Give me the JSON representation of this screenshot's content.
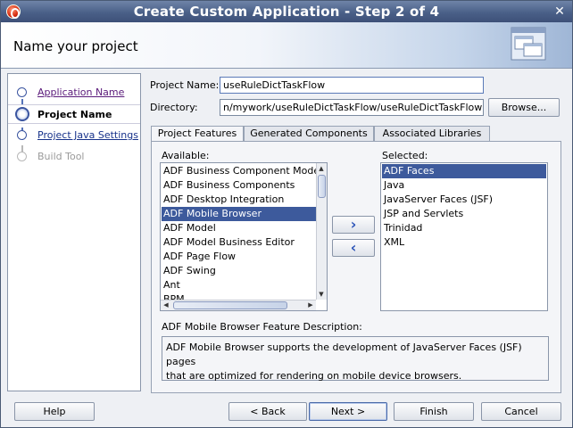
{
  "window": {
    "title": "Create Custom Application - Step 2 of 4",
    "close_glyph": "✕"
  },
  "header": {
    "title": "Name your project",
    "image": "wizard-windows-graphic"
  },
  "steps": [
    {
      "label": "Application Name",
      "state": "visited"
    },
    {
      "label": "Project Name",
      "state": "current"
    },
    {
      "label": "Project Java Settings",
      "state": "link"
    },
    {
      "label": "Build Tool",
      "state": "disabled"
    }
  ],
  "form": {
    "project_name_label": "Project Name:",
    "project_name_value": "useRuleDictTaskFlow",
    "directory_label": "Directory:",
    "directory_value": "n/mywork/useRuleDictTaskFlow/useRuleDictTaskFlow",
    "browse_label": "Browse..."
  },
  "tabs": [
    {
      "label": "Project Features",
      "active": true
    },
    {
      "label": "Generated Components",
      "active": false
    },
    {
      "label": "Associated Libraries",
      "active": false
    }
  ],
  "features": {
    "available_label": "Available:",
    "available": [
      "ADF Business Component Mode",
      "ADF Business Components",
      "ADF Desktop Integration",
      "ADF Mobile Browser",
      "ADF Model",
      "ADF Model Business Editor",
      "ADF Page Flow",
      "ADF Swing",
      "Ant",
      "BPM"
    ],
    "available_selected_index": 3,
    "selected_label": "Selected:",
    "selected": [
      "ADF Faces",
      "Java",
      "JavaServer Faces (JSF)",
      "JSP and Servlets",
      "Trinidad",
      "XML"
    ],
    "selected_selected_index": 0,
    "add_glyph": "›",
    "remove_glyph": "‹",
    "description_label": "ADF Mobile Browser Feature Description:",
    "description_line1": "ADF Mobile Browser supports the development of JavaServer Faces (JSF) pages",
    "description_line2": "that are optimized for rendering on mobile device browsers."
  },
  "footer": {
    "help": "Help",
    "back": "< Back",
    "next": "Next >",
    "finish": "Finish",
    "cancel": "Cancel"
  },
  "colors": {
    "titlebar": "#4a6088",
    "selection": "#3d5a9c",
    "link_visited": "#5a1a7a",
    "link": "#17328a"
  }
}
